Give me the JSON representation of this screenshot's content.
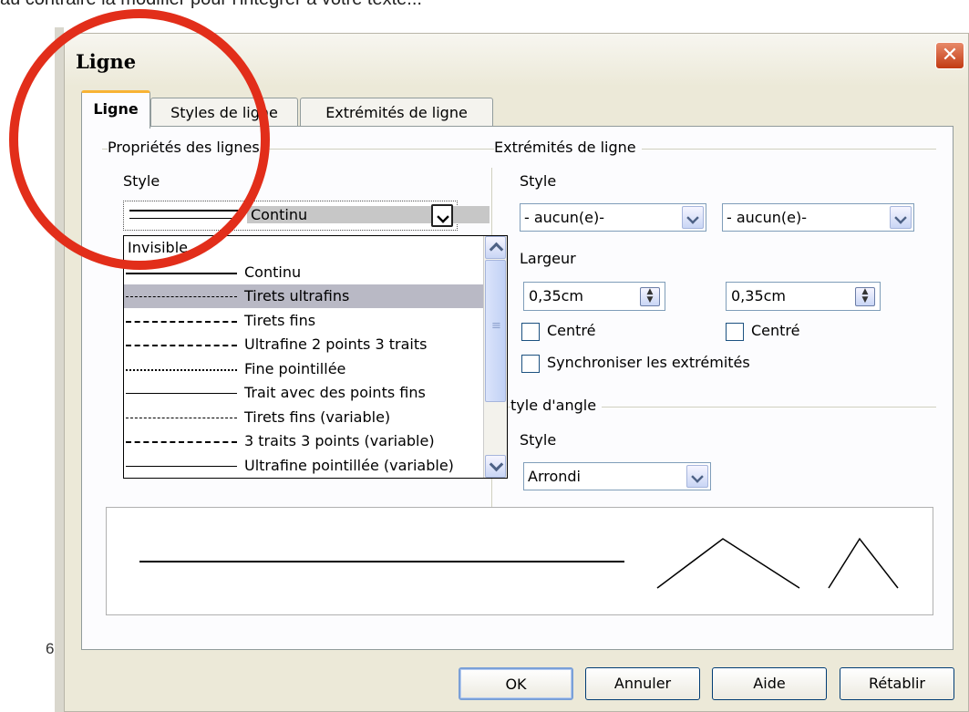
{
  "top_caption": "au contraire la modifier pour l'intégrer à votre texte...",
  "background_marks": [
    "6"
  ],
  "dialog": {
    "title": "Ligne",
    "close_glyph": "✕"
  },
  "tabs": [
    {
      "label": "Ligne",
      "active": true
    },
    {
      "label": "Styles de ligne",
      "active": false
    },
    {
      "label": "Extrémités de ligne",
      "active": false
    }
  ],
  "line_properties": {
    "group_title": "Propriétés des lignes",
    "style_label": "Style",
    "style_selected": "Continu",
    "style_options": [
      {
        "label": "Invisible",
        "line": "none",
        "selected": false
      },
      {
        "label": "Continu",
        "line": "solid",
        "selected": false
      },
      {
        "label": "Tirets ultrafins",
        "line": "dense",
        "selected": true
      },
      {
        "label": "Tirets fins",
        "line": "fins",
        "selected": false
      },
      {
        "label": "Ultrafine 2 points 3 traits",
        "line": "dashdot",
        "selected": false
      },
      {
        "label": "Fine pointillée",
        "line": "dotted",
        "selected": false
      },
      {
        "label": "Trait avec des points fins",
        "line": "thin",
        "selected": false
      },
      {
        "label": "Tirets fins (variable)",
        "line": "dashed",
        "selected": false
      },
      {
        "label": "3 traits 3 points (variable)",
        "line": "fins",
        "selected": false
      },
      {
        "label": "Ultrafine pointillée (variable)",
        "line": "thin",
        "selected": false
      }
    ]
  },
  "line_ends": {
    "group_title": "Extrémités de ligne",
    "style_label": "Style",
    "start_style": "- aucun(e)-",
    "end_style": "- aucun(e)-",
    "width_label": "Largeur",
    "start_width": "0,35cm",
    "end_width": "0,35cm",
    "start_centered_label": "Centré",
    "end_centered_label": "Centré",
    "start_centered": false,
    "end_centered": false,
    "sync_label": "Synchroniser les extrémités",
    "sync": false
  },
  "corner_style": {
    "group_title": "Style d'angle",
    "group_title_visible": "tyle d'angle",
    "style_label": "Style",
    "style_value": "Arrondi"
  },
  "buttons": {
    "ok": "OK",
    "cancel": "Annuler",
    "help": "Aide",
    "reset": "Rétablir"
  },
  "colors": {
    "dialog_bg": "#ece9d8",
    "annotation_circle": "#e22e1a",
    "tab_accent": "#f8b334",
    "close_button": "#c23a12"
  }
}
